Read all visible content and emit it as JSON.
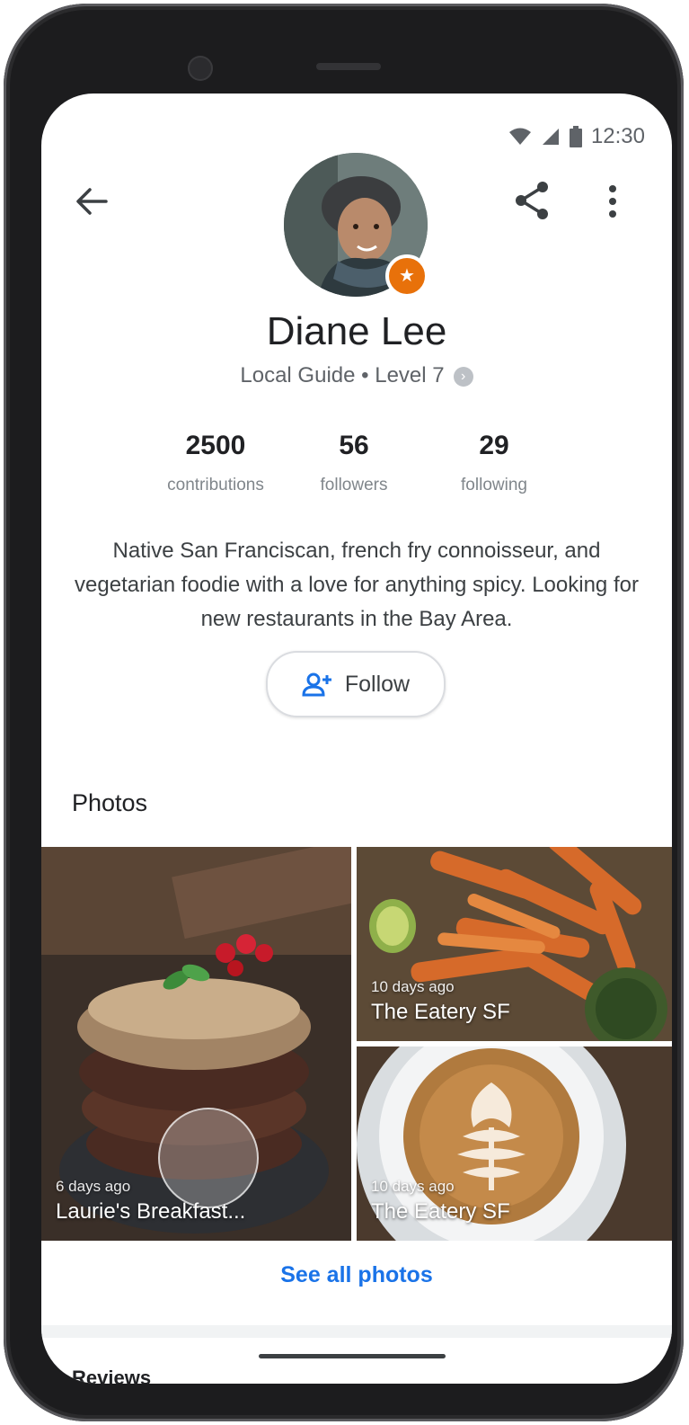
{
  "status_bar": {
    "time": "12:30",
    "icons": [
      "wifi-icon",
      "signal-icon",
      "battery-icon"
    ]
  },
  "header": {
    "icons": [
      "back-arrow-icon",
      "share-icon",
      "more-vert-icon"
    ]
  },
  "profile": {
    "name": "Diane Lee",
    "level": "Local Guide • Level 7",
    "badge_icon": "star-icon",
    "stats": [
      {
        "value": "2500",
        "label": "contributions"
      },
      {
        "value": "56",
        "label": "followers"
      },
      {
        "value": "29",
        "label": "following"
      }
    ],
    "bio": "Native San Franciscan, french fry connoisseur, and vegetarian foodie with a love for anything spicy. Looking for new restaurants in the Bay Area."
  },
  "follow_button": {
    "label": "Follow",
    "icon": "person-add-icon"
  },
  "photos": {
    "title": "Photos",
    "items": [
      {
        "ago": "6 days ago",
        "place": "Laurie's Breakfast..."
      },
      {
        "ago": "10 days ago",
        "place": "The Eatery SF"
      },
      {
        "ago": "10 days ago",
        "place": "The Eatery SF"
      }
    ],
    "see_all": "See all photos"
  },
  "next_section": {
    "title": "Reviews"
  },
  "colors": {
    "accent": "#1a73e8",
    "badge": "#e8710a",
    "text": "#202124",
    "secondary": "#5f6368"
  }
}
